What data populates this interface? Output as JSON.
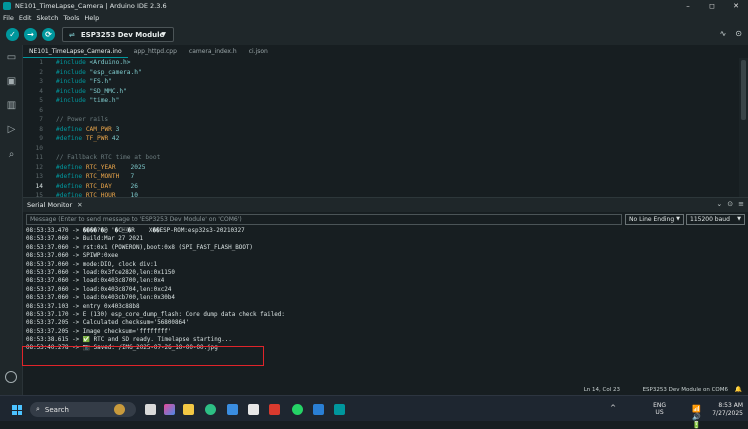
{
  "window": {
    "title": "NE101_TimeLapse_Camera | Arduino IDE 2.3.6",
    "controls": [
      "–",
      "◻",
      "✕"
    ]
  },
  "menu": [
    "File",
    "Edit",
    "Sketch",
    "Tools",
    "Help"
  ],
  "toolbar": {
    "verify_icon": "✓",
    "upload_icon": "→",
    "debug_icon": "⟳",
    "board": "ESP3253 Dev Module",
    "right_icons": [
      "∿",
      "⊙"
    ]
  },
  "tabs": [
    "NE101_TimeLapse_Camera.ino",
    "app_httpd.cpp",
    "camera_index.h",
    "ci.json"
  ],
  "editor": {
    "current_line": 14,
    "lines": [
      {
        "n": "1",
        "parts": [
          [
            "pp",
            "#include "
          ],
          [
            "str",
            "<Arduino.h>"
          ]
        ]
      },
      {
        "n": "2",
        "parts": [
          [
            "pp",
            "#include "
          ],
          [
            "str",
            "\"esp_camera.h\""
          ]
        ]
      },
      {
        "n": "3",
        "parts": [
          [
            "pp",
            "#include "
          ],
          [
            "str",
            "\"FS.h\""
          ]
        ]
      },
      {
        "n": "4",
        "parts": [
          [
            "pp",
            "#include "
          ],
          [
            "str",
            "\"SD_MMC.h\""
          ]
        ]
      },
      {
        "n": "5",
        "parts": [
          [
            "pp",
            "#include "
          ],
          [
            "str",
            "\"time.h\""
          ]
        ]
      },
      {
        "n": "6",
        "parts": []
      },
      {
        "n": "7",
        "parts": [
          [
            "cmt",
            "// Power rails"
          ]
        ]
      },
      {
        "n": "8",
        "parts": [
          [
            "pp",
            "#define "
          ],
          [
            "mac",
            "CAM_PWR "
          ],
          [
            "num",
            "3"
          ]
        ]
      },
      {
        "n": "9",
        "parts": [
          [
            "pp",
            "#define "
          ],
          [
            "mac",
            "TF_PWR "
          ],
          [
            "num",
            "42"
          ]
        ]
      },
      {
        "n": "10",
        "parts": []
      },
      {
        "n": "11",
        "parts": [
          [
            "cmt",
            "// Fallback RTC time at boot"
          ]
        ]
      },
      {
        "n": "12",
        "parts": [
          [
            "pp",
            "#define "
          ],
          [
            "mac",
            "RTC_YEAR    "
          ],
          [
            "num",
            "2025"
          ]
        ]
      },
      {
        "n": "13",
        "parts": [
          [
            "pp",
            "#define "
          ],
          [
            "mac",
            "RTC_MONTH   "
          ],
          [
            "num",
            "7"
          ]
        ]
      },
      {
        "n": "14",
        "parts": [
          [
            "pp",
            "#define "
          ],
          [
            "mac",
            "RTC_DAY     "
          ],
          [
            "num",
            "26"
          ]
        ]
      },
      {
        "n": "15",
        "parts": [
          [
            "pp",
            "#define "
          ],
          [
            "mac",
            "RTC_HOUR    "
          ],
          [
            "num",
            "10"
          ]
        ]
      }
    ]
  },
  "serial": {
    "title": "Serial Monitor",
    "close": "✕",
    "header_icons": [
      "⌄",
      "⊙",
      "≡"
    ],
    "input_placeholder": "Message (Enter to send message to 'ESP3253 Dev Module' on 'COM6')",
    "line_ending": "No Line Ending",
    "baud": "115200 baud",
    "lines": [
      "08:53:33.470 -> ����?�@ '�C\u0012�R    X��ESP-ROM:esp32s3-20210327",
      "08:53:37.060 -> Build:Mar 27 2021",
      "08:53:37.060 -> rst:0x1 (POWERON),boot:0x8 (SPI_FAST_FLASH_BOOT)",
      "08:53:37.060 -> SPIWP:0xee",
      "08:53:37.060 -> mode:DIO, clock div:1",
      "08:53:37.060 -> load:0x3fce2820,len:0x1150",
      "08:53:37.060 -> load:0x403c8700,len:0x4",
      "08:53:37.060 -> load:0x403c8704,len:0xc24",
      "08:53:37.060 -> load:0x403cb700,len:0x30b4",
      "08:53:37.103 -> entry 0x403c88b8",
      "08:53:37.170 -> E (130) esp_core_dump_flash: Core dump data check failed:",
      "08:53:37.205 -> Calculated checksum='56800864'",
      "08:53:37.205 -> Image checksum='ffffffff'",
      "08:53:38.615 -> ✅ RTC and SD ready. Timelapse starting...",
      "08:53:40.278 -> 📷 Saved: /IMG_2025-07-26_10-00-00.jpg"
    ]
  },
  "status": {
    "position": "Ln 14, Col 23",
    "board_port": "ESP3253 Dev Module on COM6",
    "bell": "🔔"
  },
  "taskbar": {
    "search_label": "Search",
    "search_icon": "⌕",
    "chevron": "^",
    "lang_1": "ENG",
    "lang_2": "US",
    "sys_icons": "📶🔊🔋",
    "time": "8:53 AM",
    "date": "7/27/2025"
  },
  "colors": {
    "accent": "#00979d",
    "highlight_border": "#e0242a"
  }
}
